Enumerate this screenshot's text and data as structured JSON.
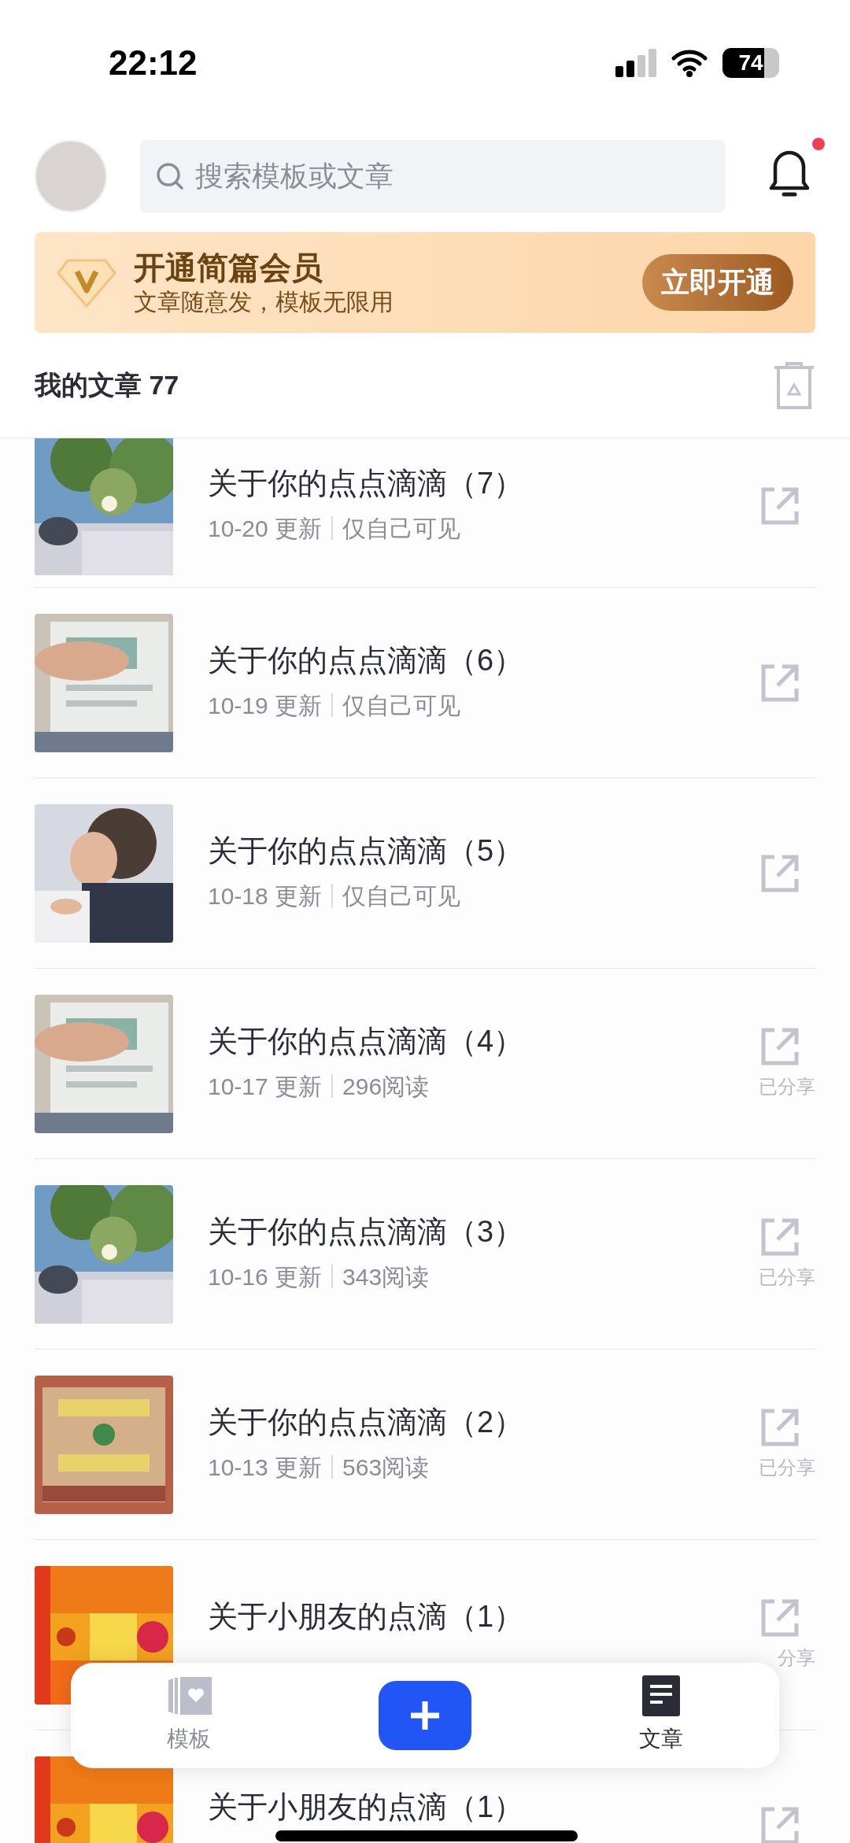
{
  "status_bar": {
    "time": "22:12",
    "battery": "74"
  },
  "header": {
    "search": {
      "placeholder": "搜索模板或文章"
    },
    "has_unread": true
  },
  "banner": {
    "title": "开通简篇会员",
    "subtitle": "文章随意发，模板无限用",
    "button": "立即开通"
  },
  "section": {
    "title": "我的文章 77"
  },
  "articles": [
    {
      "title": "关于你的点点滴滴（7）",
      "date": "10-20 更新",
      "info": "仅自己可见"
    },
    {
      "title": "关于你的点点滴滴（6）",
      "date": "10-19 更新",
      "info": "仅自己可见"
    },
    {
      "title": "关于你的点点滴滴（5）",
      "date": "10-18 更新",
      "info": "仅自己可见"
    },
    {
      "title": "关于你的点点滴滴（4）",
      "date": "10-17 更新",
      "info": "296阅读",
      "share_label": "已分享"
    },
    {
      "title": "关于你的点点滴滴（3）",
      "date": "10-16 更新",
      "info": "343阅读",
      "share_label": "已分享"
    },
    {
      "title": "关于你的点点滴滴（2）",
      "date": "10-13 更新",
      "info": "563阅读",
      "share_label": "已分享"
    },
    {
      "title": "关于小朋友的点滴（1）",
      "share_label": "分享"
    },
    {
      "title": "关于小朋友的点滴（1）"
    }
  ],
  "bottom_nav": [
    {
      "kind": "tab",
      "label": "模板",
      "selected": false
    },
    {
      "kind": "add"
    },
    {
      "kind": "tab",
      "label": "文章",
      "selected": true
    }
  ]
}
